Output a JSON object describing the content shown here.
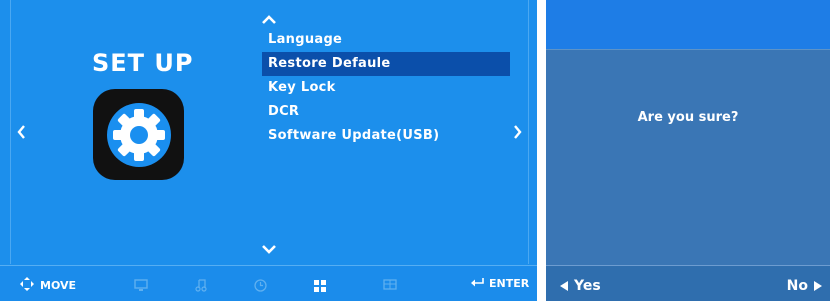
{
  "setup_screen": {
    "title": "SET UP",
    "icon": "gear-icon",
    "menu_items": [
      {
        "label": "Language",
        "selected": false
      },
      {
        "label": "Restore Defaule",
        "selected": true
      },
      {
        "label": "Key Lock",
        "selected": false
      },
      {
        "label": "DCR",
        "selected": false
      },
      {
        "label": "Software Update(USB)",
        "selected": false
      }
    ],
    "bottom_bar": {
      "move_label": "MOVE",
      "enter_label": "ENTER",
      "category_icons": [
        "monitor-icon",
        "music-icon",
        "clock-icon",
        "grid-icon",
        "picture-icon"
      ],
      "active_category": "grid-icon"
    }
  },
  "confirm_dialog": {
    "message": "Are you sure?",
    "yes_label": "Yes",
    "no_label": "No"
  },
  "colors": {
    "panel_bg": "#1c8fec",
    "selected_bg": "#0b4faa",
    "dialog_bg": "#3a76b5",
    "dialog_header_bg": "#1e7de6"
  }
}
